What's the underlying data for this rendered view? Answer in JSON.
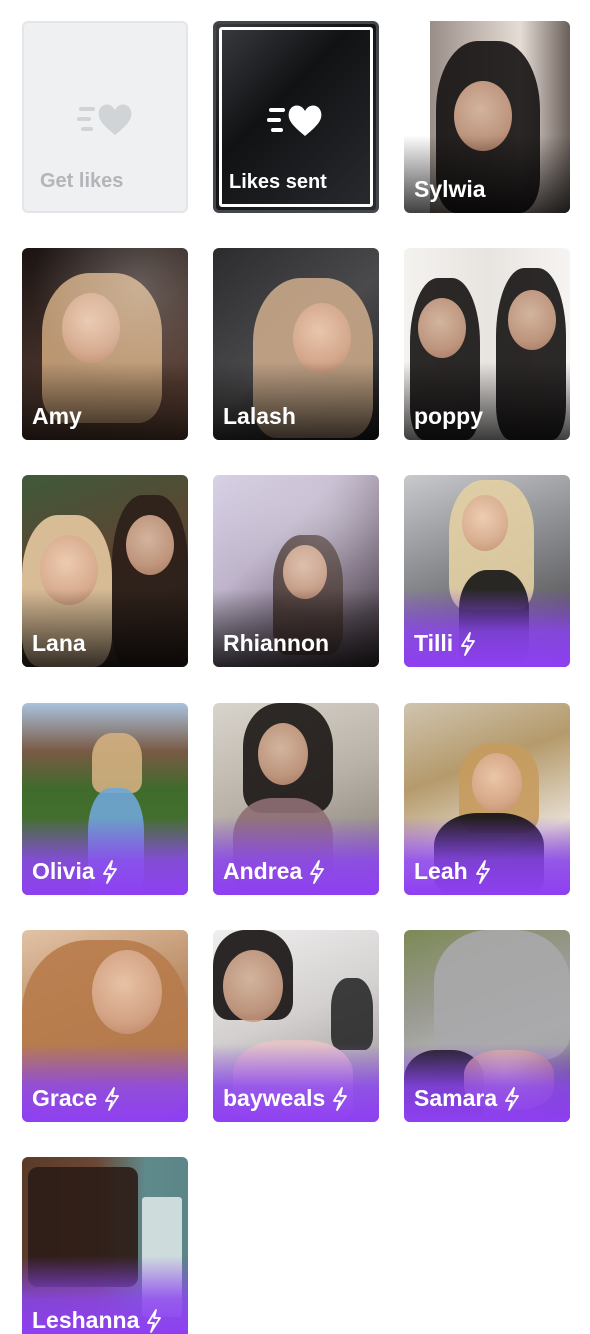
{
  "tiles": {
    "get_likes": {
      "label": "Get likes",
      "icon": "heart-send-icon"
    },
    "likes_sent": {
      "label": "Likes sent",
      "icon": "heart-send-icon"
    }
  },
  "profiles": [
    {
      "name": "Sylwia",
      "boosted": false
    },
    {
      "name": "Amy",
      "boosted": false
    },
    {
      "name": "Lalash",
      "boosted": false
    },
    {
      "name": "poppy",
      "boosted": false
    },
    {
      "name": "Lana",
      "boosted": false
    },
    {
      "name": "Rhiannon",
      "boosted": false
    },
    {
      "name": "Tilli",
      "boosted": true
    },
    {
      "name": "Olivia",
      "boosted": true
    },
    {
      "name": "Andrea",
      "boosted": true
    },
    {
      "name": "Leah",
      "boosted": true
    },
    {
      "name": "Grace",
      "boosted": true
    },
    {
      "name": "bayweals",
      "boosted": true
    },
    {
      "name": "Samara",
      "boosted": true
    },
    {
      "name": "Leshanna",
      "boosted": true
    }
  ],
  "colors": {
    "boost_purple": "#8f3ff2",
    "tile_grey": "#eef0f2",
    "tile_dark": "#111214"
  }
}
